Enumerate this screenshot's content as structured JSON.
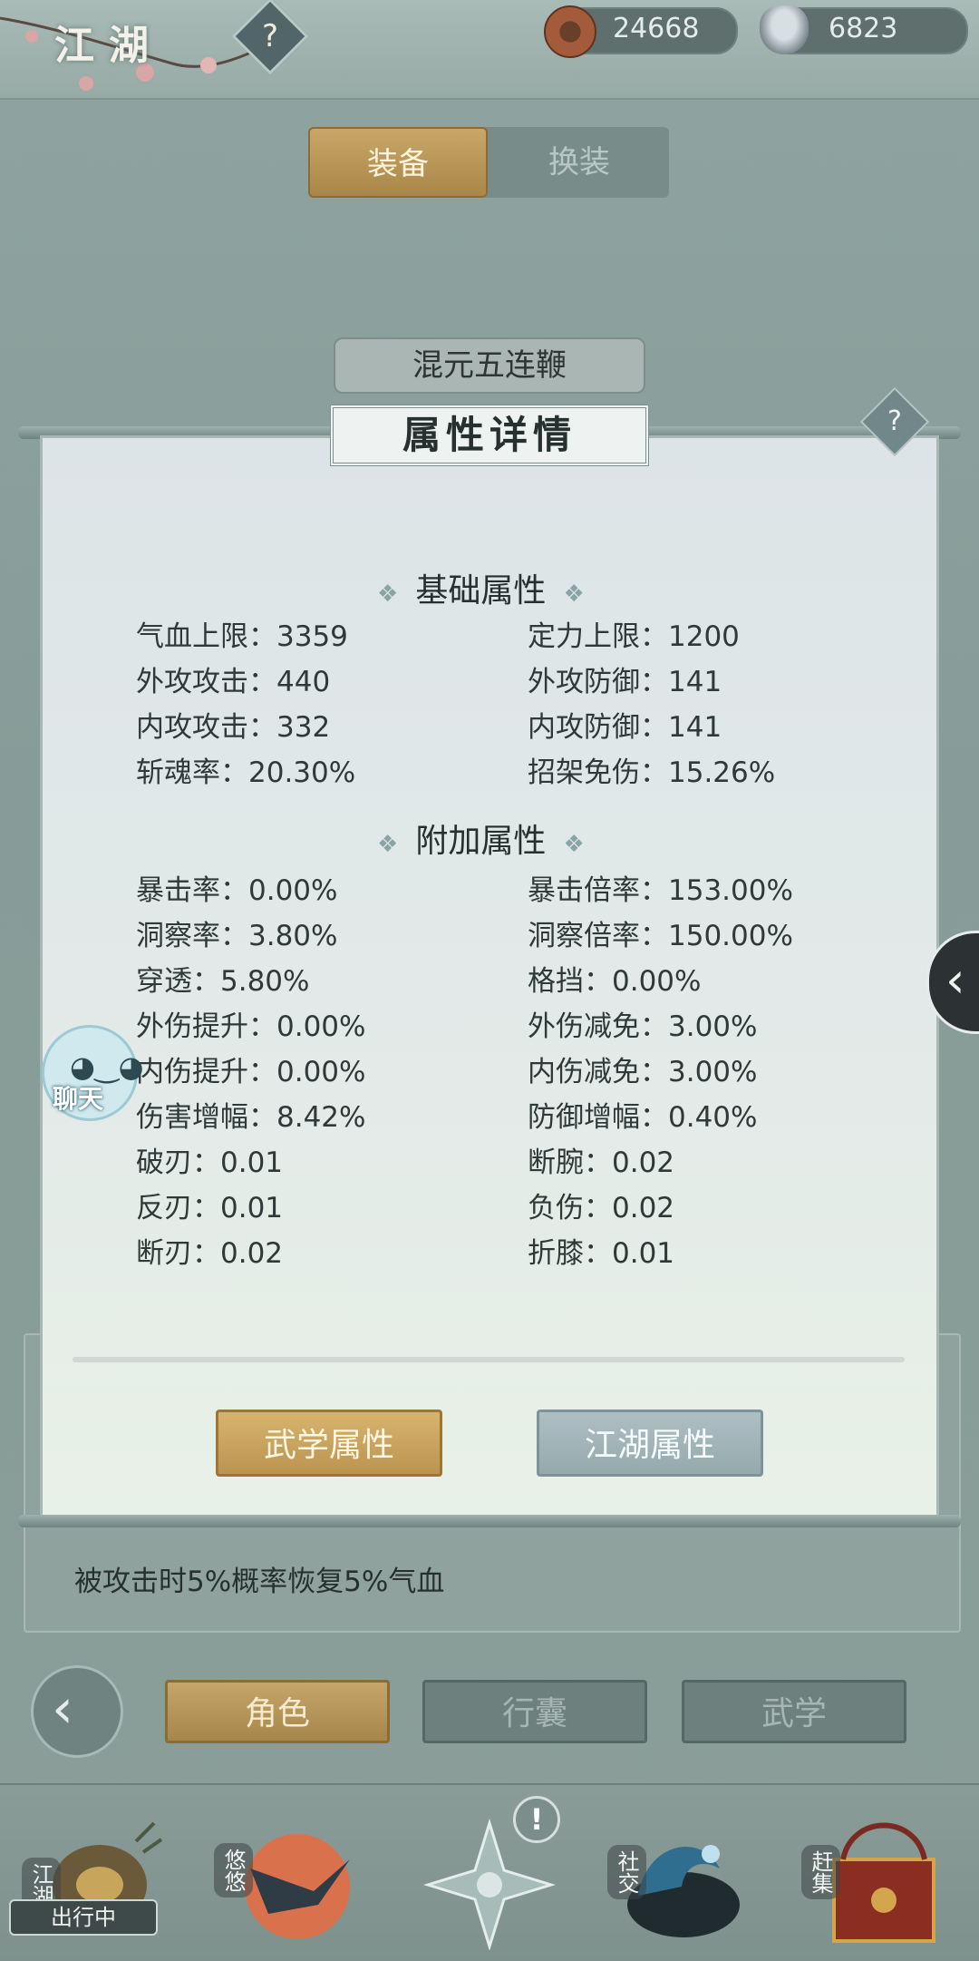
{
  "header": {
    "title": "江湖",
    "help_icon": "question-mark-icon",
    "currency": [
      {
        "icon": "copper-coin-icon",
        "value": "24668"
      },
      {
        "icon": "silver-ingot-icon",
        "value": "6823"
      }
    ]
  },
  "tabs": [
    {
      "label": "装备",
      "active": true
    },
    {
      "label": "换装",
      "active": false
    }
  ],
  "weapon_name": "混元五连鞭",
  "panel": {
    "title": "属性详情",
    "help_icon": "?",
    "base": {
      "title": "基础属性",
      "stats": [
        [
          "气血上限：3359",
          "定力上限：1200"
        ],
        [
          "外攻攻击：440",
          "外攻防御：141"
        ],
        [
          "内攻攻击：332",
          "内攻防御：141"
        ],
        [
          "斩魂率：20.30%",
          "招架免伤：15.26%"
        ]
      ]
    },
    "extra": {
      "title": "附加属性",
      "stats": [
        [
          "暴击率：0.00%",
          "暴击倍率：153.00%"
        ],
        [
          "洞察率：3.80%",
          "洞察倍率：150.00%"
        ],
        [
          "穿透：5.80%",
          "格挡：0.00%"
        ],
        [
          "外伤提升：0.00%",
          "外伤减免：3.00%"
        ],
        [
          "内伤提升：0.00%",
          "内伤减免：3.00%"
        ],
        [
          "伤害增幅：8.42%",
          "防御增幅：0.40%"
        ],
        [
          "破刃：0.01",
          "断腕：0.02"
        ],
        [
          "反刃：0.01",
          "负伤：0.02"
        ],
        [
          "断刃：0.02",
          "折膝：0.01"
        ]
      ]
    },
    "buttons": {
      "martial": "武学属性",
      "jianghu": "江湖属性"
    }
  },
  "effect_text": "被攻击时5%概率恢复5%气血",
  "chat_label": "聊天",
  "side_handle_icon": "chevron-left-icon",
  "nav": {
    "role": "角色",
    "bag": "行囊",
    "martial": "武学",
    "back_icon": "back-arrow-icon"
  },
  "dock": {
    "items": [
      {
        "label": "江湖",
        "icon": "jianghu-map-icon"
      },
      {
        "label": "悠悠",
        "icon": "swallow-sunset-icon"
      },
      {
        "label": "",
        "icon": "compass-star-icon"
      },
      {
        "label": "社交",
        "icon": "wave-social-icon"
      },
      {
        "label": "赶集",
        "icon": "market-basket-icon"
      }
    ],
    "status": "出行中",
    "alert_icon": "!"
  },
  "colors": {
    "accent_gold": "#c9a76a",
    "panel_bg": "#e3eae8",
    "frame": "#7c918d"
  }
}
